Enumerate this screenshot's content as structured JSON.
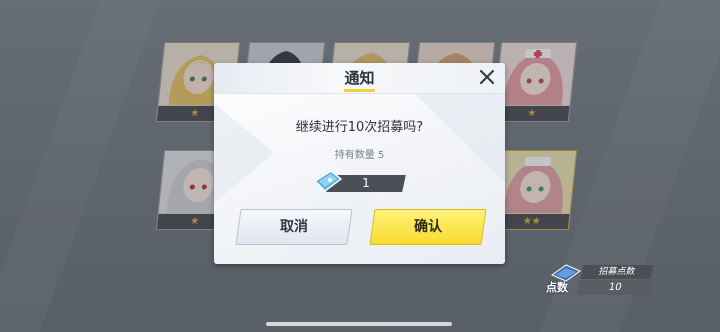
{
  "dialog": {
    "title": "通知",
    "message": "继续进行10次招募吗?",
    "holding_text": "持有数量 5",
    "cost_value": "1",
    "cancel_label": "取消",
    "confirm_label": "确认"
  },
  "recruit_points": {
    "label": "招募点数",
    "unit": "点数",
    "value": "10"
  },
  "cards": [
    {
      "stars": "★"
    },
    {
      "stars": ""
    },
    {
      "stars": ""
    },
    {
      "stars": ""
    },
    {
      "stars": "★"
    },
    {
      "stars": "★"
    },
    {
      "stars": "★★"
    }
  ],
  "colors": {
    "accent_yellow": "#f6dc2f",
    "dialog_bg": "#f1f3f7",
    "dark_panel": "#4c4f56",
    "star_gold": "#e3b33b"
  },
  "icons": {
    "close": "close-icon",
    "ticket": "recruit-ticket-icon",
    "points": "recruit-points-icon"
  }
}
